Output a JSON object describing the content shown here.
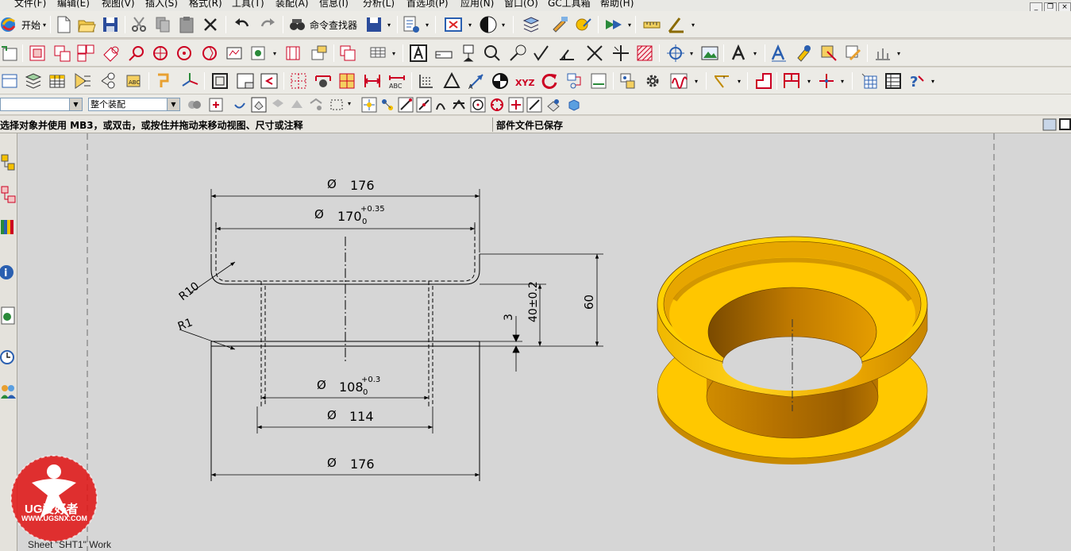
{
  "menu": [
    {
      "label": "文件(F)"
    },
    {
      "label": "编辑(E)"
    },
    {
      "label": "视图(V)"
    },
    {
      "label": "插入(S)"
    },
    {
      "label": "格式(R)"
    },
    {
      "label": "工具(T)"
    },
    {
      "label": "装配(A)"
    },
    {
      "label": "信息(I)"
    },
    {
      "label": "分析(L)"
    },
    {
      "label": "首选项(P)"
    },
    {
      "label": "应用(N)"
    },
    {
      "label": "窗口(O)"
    },
    {
      "label": "GC工具箱"
    },
    {
      "label": "帮助(H)"
    }
  ],
  "toolbar": {
    "start_label": "开始",
    "command_finder_label": "命令查找器"
  },
  "selection": {
    "filter_value": "",
    "scope_value": "整个装配"
  },
  "status": {
    "prompt": "选择对象并使用 MB3，或双击，或按住并拖动来移动视图、尺寸或注释",
    "message": "部件文件已保存"
  },
  "drawing": {
    "dim_top_176": "176",
    "dim_170": "170",
    "dim_170_tol_upper": "+0.35",
    "dim_170_tol_lower": "0",
    "dim_108": "108",
    "dim_108_tol_upper": "+0.3",
    "dim_108_tol_lower": "0",
    "dim_114": "114",
    "dim_bottom_176": "176",
    "dim_60": "60",
    "dim_40": "40±0.2",
    "dim_3": "3",
    "radius_r10": "R10",
    "radius_r1": "R1",
    "diameter_symbol": "Ø",
    "sheet_label": "Sheet \"SHT1\" Work",
    "part_color": "#f5c000"
  },
  "logo": {
    "brand": "UG爱好者",
    "url": "WWW.UGSNX.COM"
  }
}
